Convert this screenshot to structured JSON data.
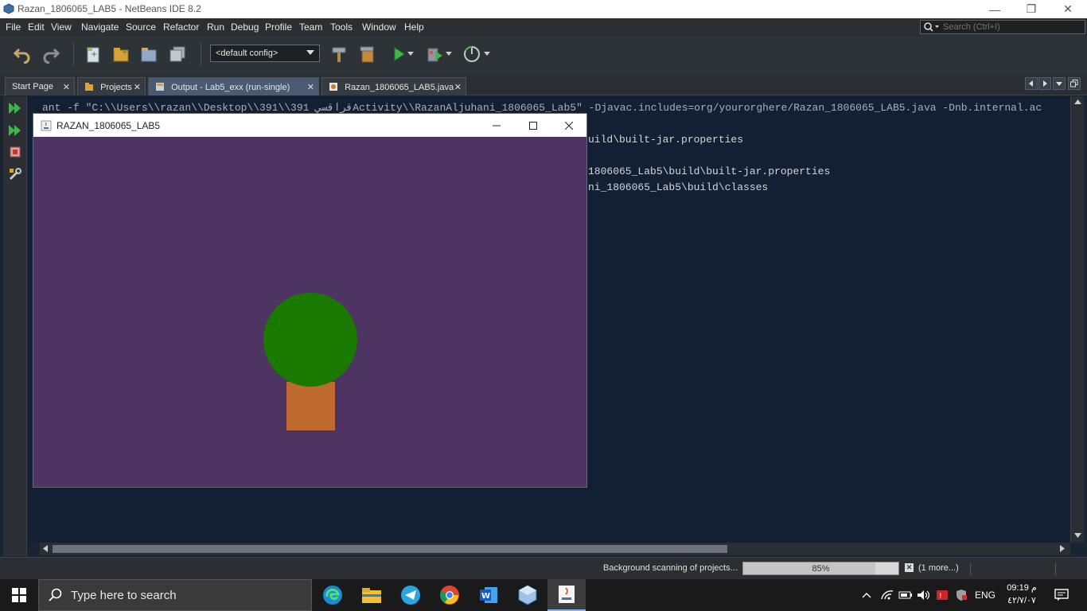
{
  "window": {
    "title": "Razan_1806065_LAB5 - NetBeans IDE 8.2"
  },
  "menu": [
    "File",
    "Edit",
    "View",
    "Navigate",
    "Source",
    "Refactor",
    "Run",
    "Debug",
    "Profile",
    "Team",
    "Tools",
    "Window",
    "Help"
  ],
  "search": {
    "placeholder": "Search (Ctrl+I)"
  },
  "toolbar": {
    "config": "<default config>"
  },
  "tabs": [
    {
      "label": "Start Page",
      "active": false
    },
    {
      "label": "Projects",
      "active": false
    },
    {
      "label": "Output - Lab5_exx (run-single)",
      "active": true
    },
    {
      "label": "Razan_1806065_LAB5.java",
      "active": false
    }
  ],
  "output": {
    "lines": [
      "ant -f \"C:\\\\Users\\\\razan\\\\Desktop\\\\391\\\\391 قراقسيActivity\\\\RazanAljuhani_1806065_Lab5\" -Djavac.includes=org/yourorghere/Razan_1806065_LAB5.java -Dnb.internal.ac",
      "uild\\built-jar.properties",
      "1806065_Lab5\\build\\built-jar.properties",
      "ni_1806065_Lab5\\build\\classes"
    ]
  },
  "java_window": {
    "title": "RAZAN_1806065_LAB5",
    "background": "#4d3462",
    "trunk_color": "#bf6a2e",
    "foliage_color": "#1a7a00"
  },
  "status": {
    "message": "Background scanning of projects...",
    "progress_value": 0.85,
    "progress_label": "85%",
    "more": "(1 more...)"
  },
  "taskbar": {
    "search_text": "Type here to search",
    "apps": [
      "edge-icon",
      "file-explorer-icon",
      "telegram-icon",
      "chrome-icon",
      "word-icon",
      "virtualbox-icon",
      "java-icon"
    ],
    "language": "ENG",
    "time": "09:19 م",
    "date": "٤٢/٧/٠٧"
  }
}
